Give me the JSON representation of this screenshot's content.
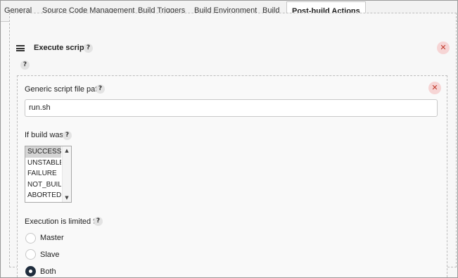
{
  "tabs": [
    {
      "label": "General"
    },
    {
      "label": "Source Code Management"
    },
    {
      "label": "Build Triggers"
    },
    {
      "label": "Build Environment"
    },
    {
      "label": "Build"
    },
    {
      "label": "Post-build Actions",
      "active": true
    }
  ],
  "section": {
    "title": "Execute scripts",
    "help": "?",
    "remove_glyph": "✕"
  },
  "script": {
    "path_label": "Generic script file path",
    "path_value": "run.sh",
    "help": "?",
    "remove_glyph": "✕"
  },
  "build_status": {
    "label": "If build was",
    "help": "?",
    "options": [
      "SUCCESS",
      "UNSTABLE",
      "FAILURE",
      "NOT_BUILT",
      "ABORTED"
    ],
    "selected": "SUCCESS",
    "scroll_up": "▲",
    "scroll_down": "▼"
  },
  "execution": {
    "label": "Execution is limited to",
    "help": "?",
    "options": [
      "Master",
      "Slave",
      "Both"
    ],
    "selected": "Both"
  },
  "icons": {
    "drag": "drag-handle-icon",
    "help": "help-icon",
    "close": "close-icon"
  },
  "colors": {
    "close_bg": "#f6d5d5",
    "close_fg": "#c0392b",
    "radio_checked": "#1f2d3d",
    "selected_option": "#d4d4d4"
  }
}
